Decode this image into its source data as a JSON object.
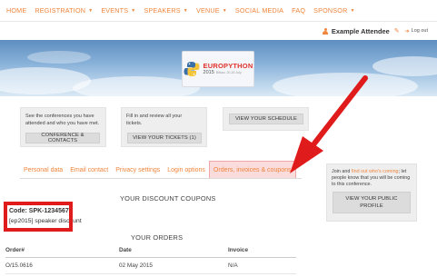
{
  "nav": {
    "items": [
      {
        "label": "HOME",
        "caret": false
      },
      {
        "label": "REGISTRATION",
        "caret": true
      },
      {
        "label": "EVENTS",
        "caret": true
      },
      {
        "label": "SPEAKERS",
        "caret": true
      },
      {
        "label": "VENUE",
        "caret": true
      },
      {
        "label": "SOCIAL MEDIA",
        "caret": false
      },
      {
        "label": "FAQ",
        "caret": false
      },
      {
        "label": "SPONSOR",
        "caret": true
      }
    ]
  },
  "user": {
    "name": "Example Attendee",
    "logout_label": "Log out"
  },
  "logo": {
    "title": "EUROPYTHON",
    "year": "2015",
    "subtitle": "Bilbao, 20-26 July"
  },
  "cards": [
    {
      "text": "See the conferences you have attended and who you have met.",
      "button": "CONFERENCE & CONTACTS"
    },
    {
      "text": "Fill in and review all your tickets.",
      "button": "VIEW YOUR TICKETS (1)"
    },
    {
      "text": "",
      "button": "VIEW YOUR SCHEDULE"
    }
  ],
  "tabs": [
    {
      "label": "Personal data",
      "active": false
    },
    {
      "label": "Email contact",
      "active": false
    },
    {
      "label": "Privacy settings",
      "active": false
    },
    {
      "label": "Login options",
      "active": false
    },
    {
      "label": "Orders, invoices & coupons",
      "active": true
    }
  ],
  "sidebar": {
    "text_pre": "Join and ",
    "link": "find out who's coming",
    "text_post": "; let people know that you will be coming to this conference.",
    "button": "VIEW YOUR PUBLIC PROFILE"
  },
  "coupons": {
    "title": "YOUR DISCOUNT COUPONS",
    "code_label": "Code: SPK-12345678",
    "description": "[ep2015] speaker discount"
  },
  "orders": {
    "title": "YOUR ORDERS",
    "columns": [
      "Order#",
      "Date",
      "Invoice"
    ],
    "rows": [
      [
        "O/15.0616",
        "02 May 2015",
        "N/A"
      ]
    ]
  },
  "colors": {
    "accent": "#f0843b",
    "highlight": "#e01b1b",
    "active_tab_bg": "#fbdcdc"
  }
}
